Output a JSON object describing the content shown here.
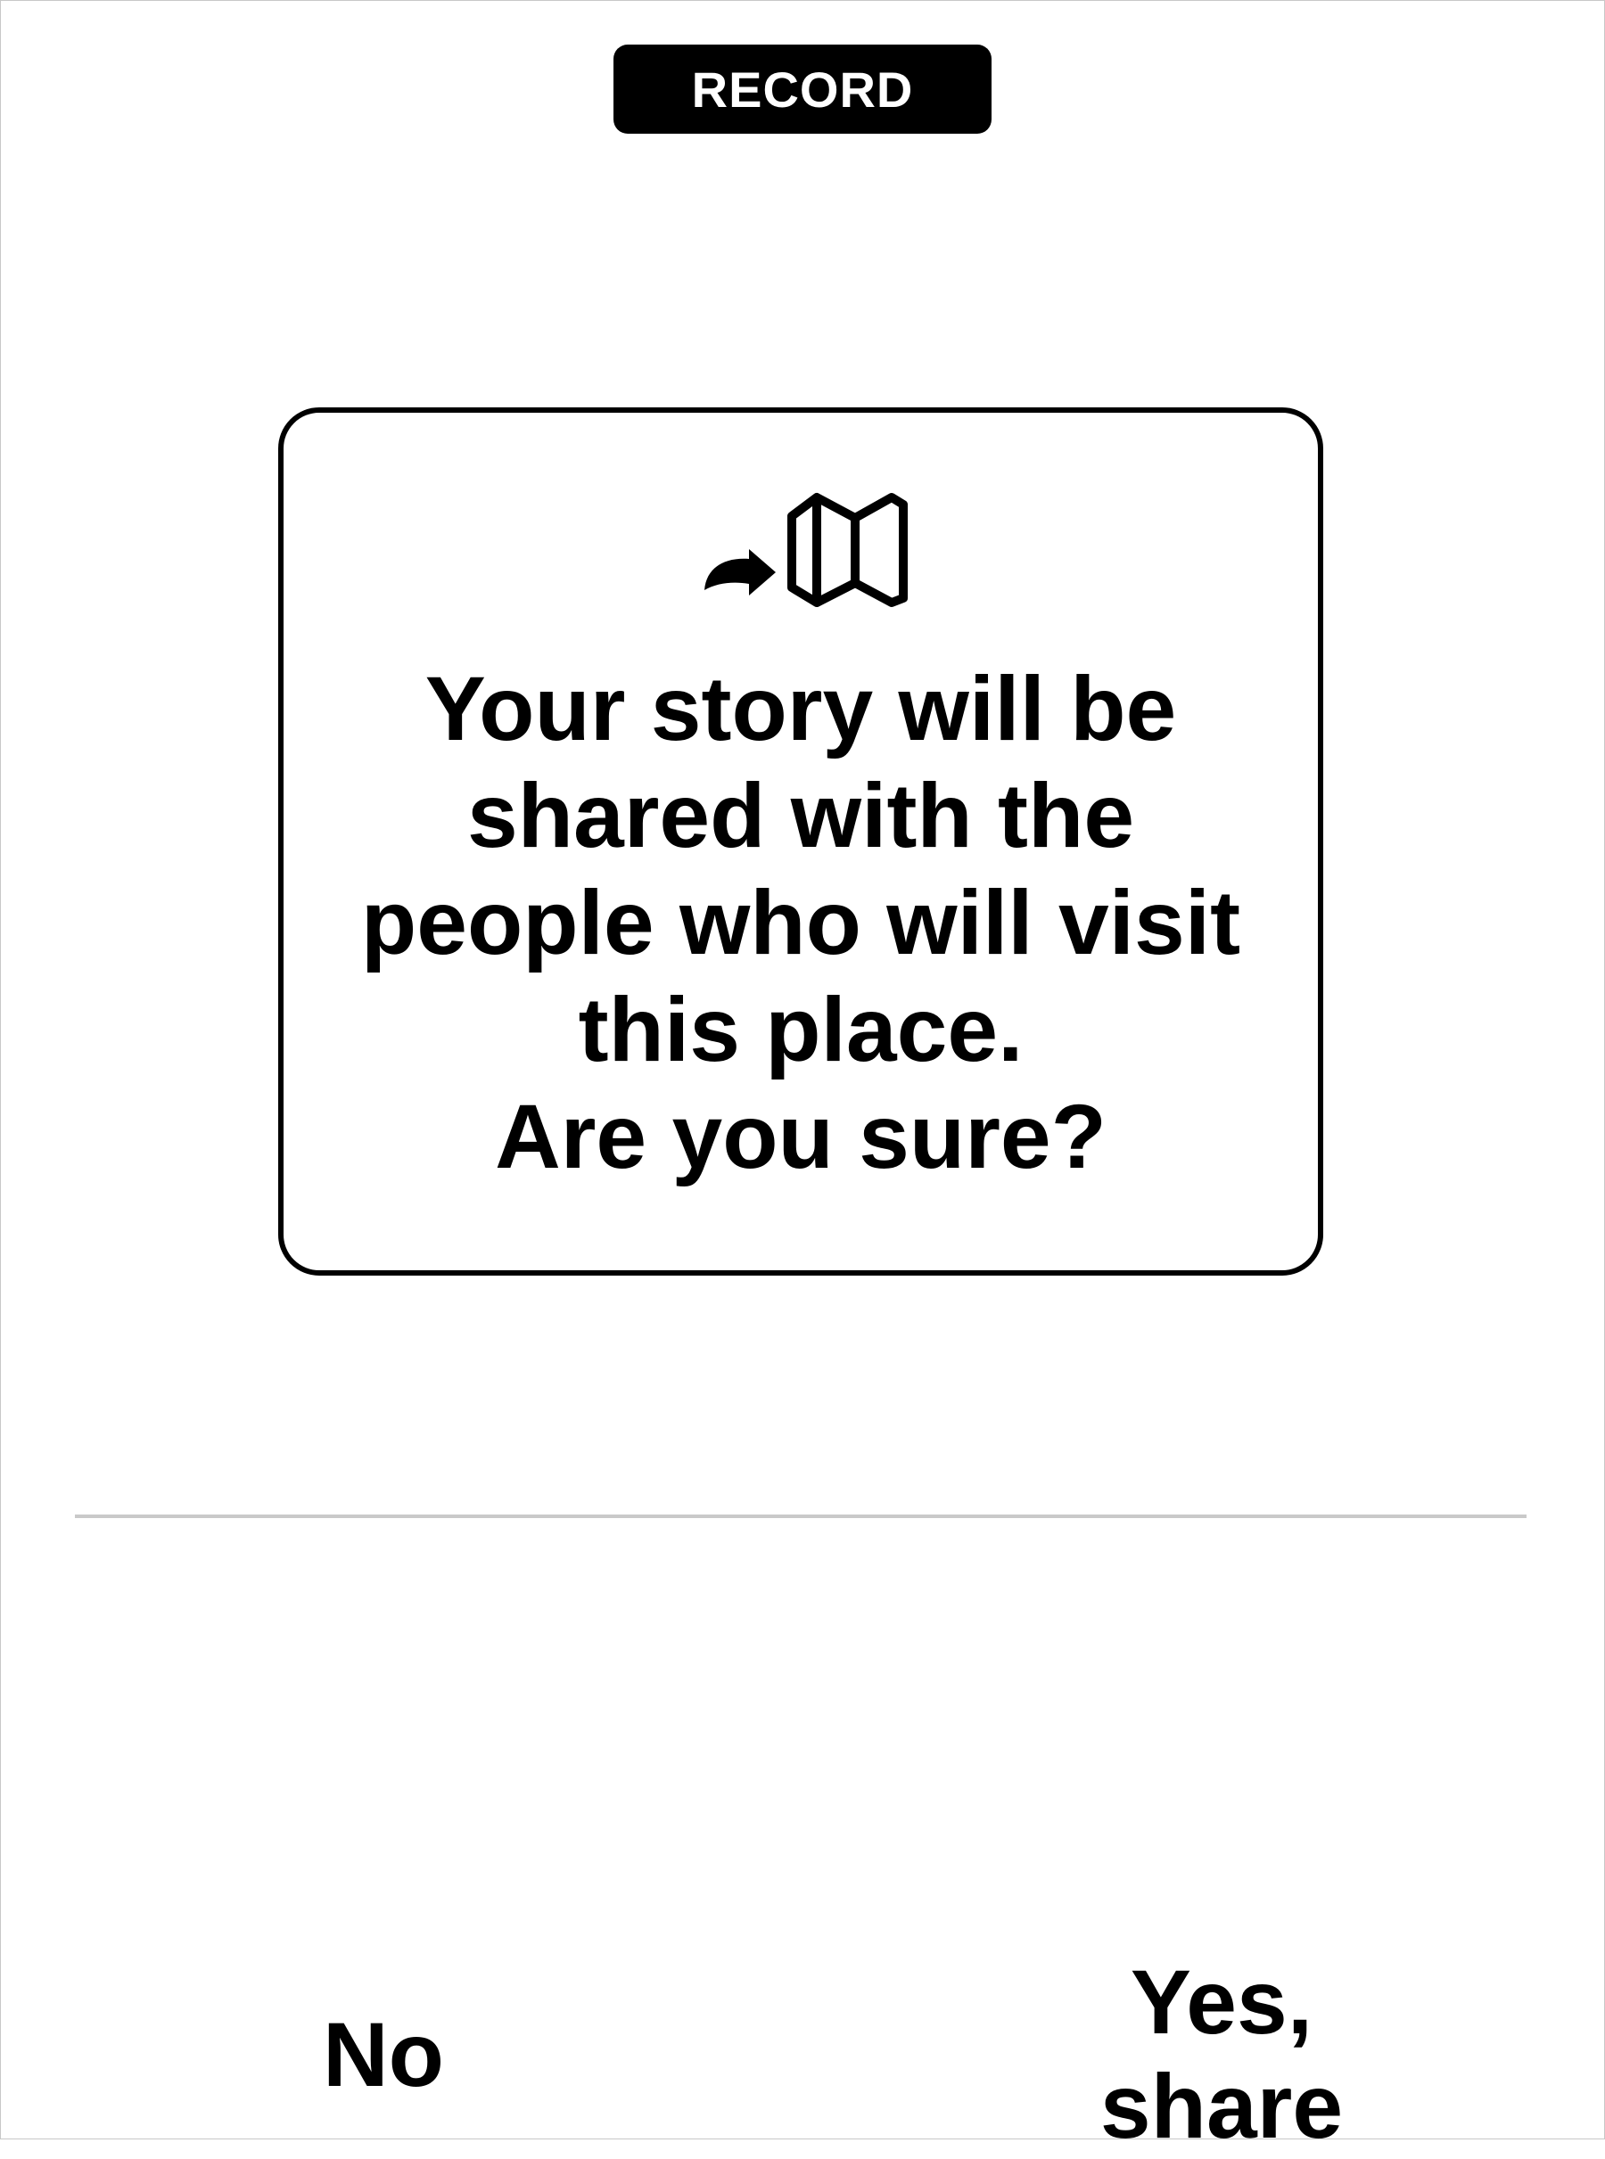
{
  "header": {
    "badge_label": "RECORD"
  },
  "dialog": {
    "icon": "share-to-map-icon",
    "message": "Your story will be\nshared with the\npeople who will visit\nthis place.\nAre you sure?"
  },
  "actions": {
    "no_label": "No",
    "yes_label": "Yes, share"
  },
  "colors": {
    "text": "#000000",
    "background": "#ffffff",
    "badge_background": "#000000",
    "badge_text": "#ffffff",
    "divider": "#c9c9c9"
  }
}
